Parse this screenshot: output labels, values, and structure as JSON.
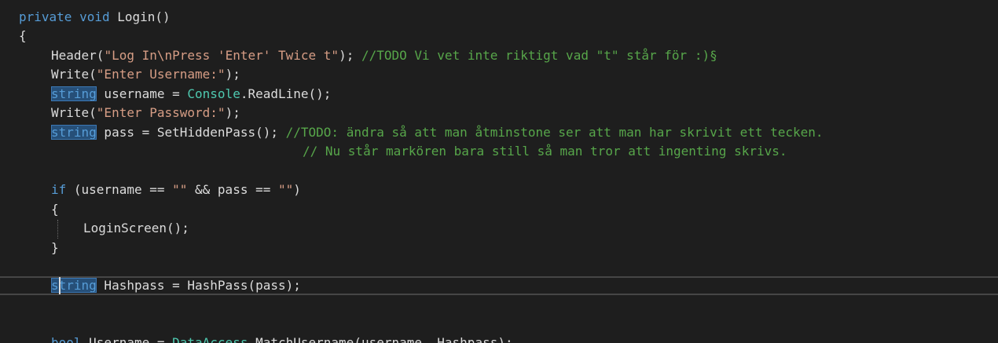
{
  "colors": {
    "background": "#1e1e1e",
    "keyword": "#569cd6",
    "string": "#d69d85",
    "comment": "#57a64a",
    "type": "#4ec9b0",
    "text": "#dcdcdc",
    "highlight": "#264f78"
  },
  "code": {
    "l1": {
      "k1": "private",
      "s1": " ",
      "k2": "void",
      "t1": " Login()"
    },
    "l2": {
      "t1": "{"
    },
    "l3": {
      "t1": "Header(",
      "s1": "\"Log In\\nPress 'Enter' Twice t\"",
      "t2": "); ",
      "c1": "//TODO Vi vet inte riktigt vad \"t\" står för :)§"
    },
    "l4": {
      "t1": "Write(",
      "s1": "\"Enter Username:\"",
      "t2": ");"
    },
    "l5": {
      "k1": "string",
      "t1": " username = ",
      "y1": "Console",
      "t2": ".ReadLine();"
    },
    "l6": {
      "t1": "Write(",
      "s1": "\"Enter Password:\"",
      "t2": ");"
    },
    "l7": {
      "k1": "string",
      "t1": " pass = SetHiddenPass(); ",
      "c1": "//TODO: ändra så att man åtminstone ser att man har skrivit ett tecken."
    },
    "l8": {
      "c1": "// Nu står markören bara still så man tror att ingenting skrivs."
    },
    "l9": {
      "k1": "if",
      "t1": " (username == ",
      "s1": "\"\"",
      "t2": " && pass == ",
      "s2": "\"\"",
      "t3": ")"
    },
    "l10": {
      "t1": "{"
    },
    "l11": {
      "t1": "LoginScreen();"
    },
    "l12": {
      "t1": "}"
    },
    "l13": {
      "k1": "string",
      "t1": " Hashpass = HashPass(pass);"
    },
    "l14": {
      "k1": "bool",
      "t1": " Username = ",
      "y1": "DataAccess",
      "t2": ".MatchUsername(username, Hashpass);"
    }
  }
}
